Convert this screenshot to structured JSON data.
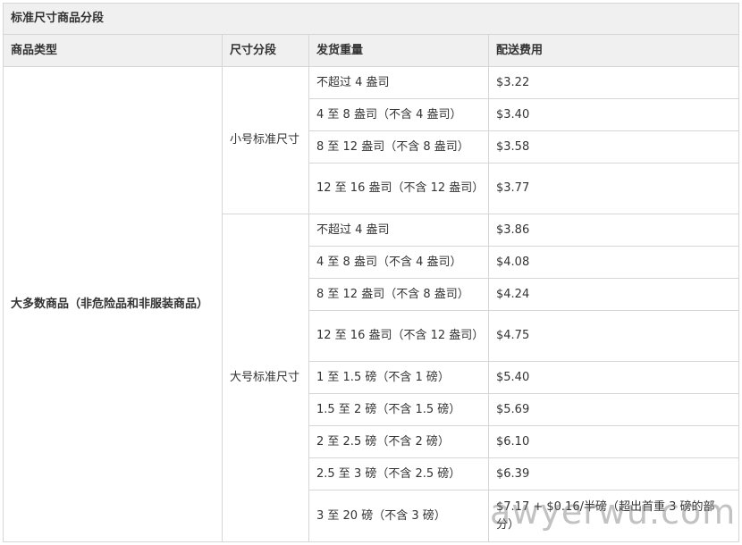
{
  "table_title": "标准尺寸商品分段",
  "headers": [
    "商品类型",
    "尺寸分段",
    "发货重量",
    "配送费用"
  ],
  "category": "大多数商品（非危险品和非服装商品）",
  "tiers": [
    {
      "name": "小号标准尺寸",
      "rows": [
        {
          "weight": "不超过 4 盎司",
          "fee": "$3.22"
        },
        {
          "weight": "4 至 8 盎司（不含 4 盎司）",
          "fee": "$3.40"
        },
        {
          "weight": "8 至 12 盎司（不含 8 盎司）",
          "fee": "$3.58"
        },
        {
          "weight": "12 至 16 盎司（不含 12 盎司）",
          "fee": "$3.77"
        }
      ]
    },
    {
      "name": "大号标准尺寸",
      "rows": [
        {
          "weight": "不超过 4 盎司",
          "fee": "$3.86"
        },
        {
          "weight": "4 至 8 盎司（不含 4 盎司）",
          "fee": "$4.08"
        },
        {
          "weight": "8 至 12 盎司（不含 8 盎司）",
          "fee": "$4.24"
        },
        {
          "weight": "12 至 16 盎司（不含 12 盎司）",
          "fee": "$4.75"
        },
        {
          "weight": "1 至 1.5 磅（不含 1 磅）",
          "fee": "$5.40"
        },
        {
          "weight": "1.5 至 2 磅（不含 1.5 磅）",
          "fee": "$5.69"
        },
        {
          "weight": "2 至 2.5 磅（不含 2 磅）",
          "fee": "$6.10"
        },
        {
          "weight": "2.5 至 3 磅（不含 2.5 磅）",
          "fee": "$6.39"
        },
        {
          "weight": "3 至 20 磅（不含 3 磅）",
          "fee": "$7.17 + $0.16/半磅（超出首重 3 磅的部分）"
        }
      ]
    }
  ],
  "watermark": "awyerwu.com"
}
